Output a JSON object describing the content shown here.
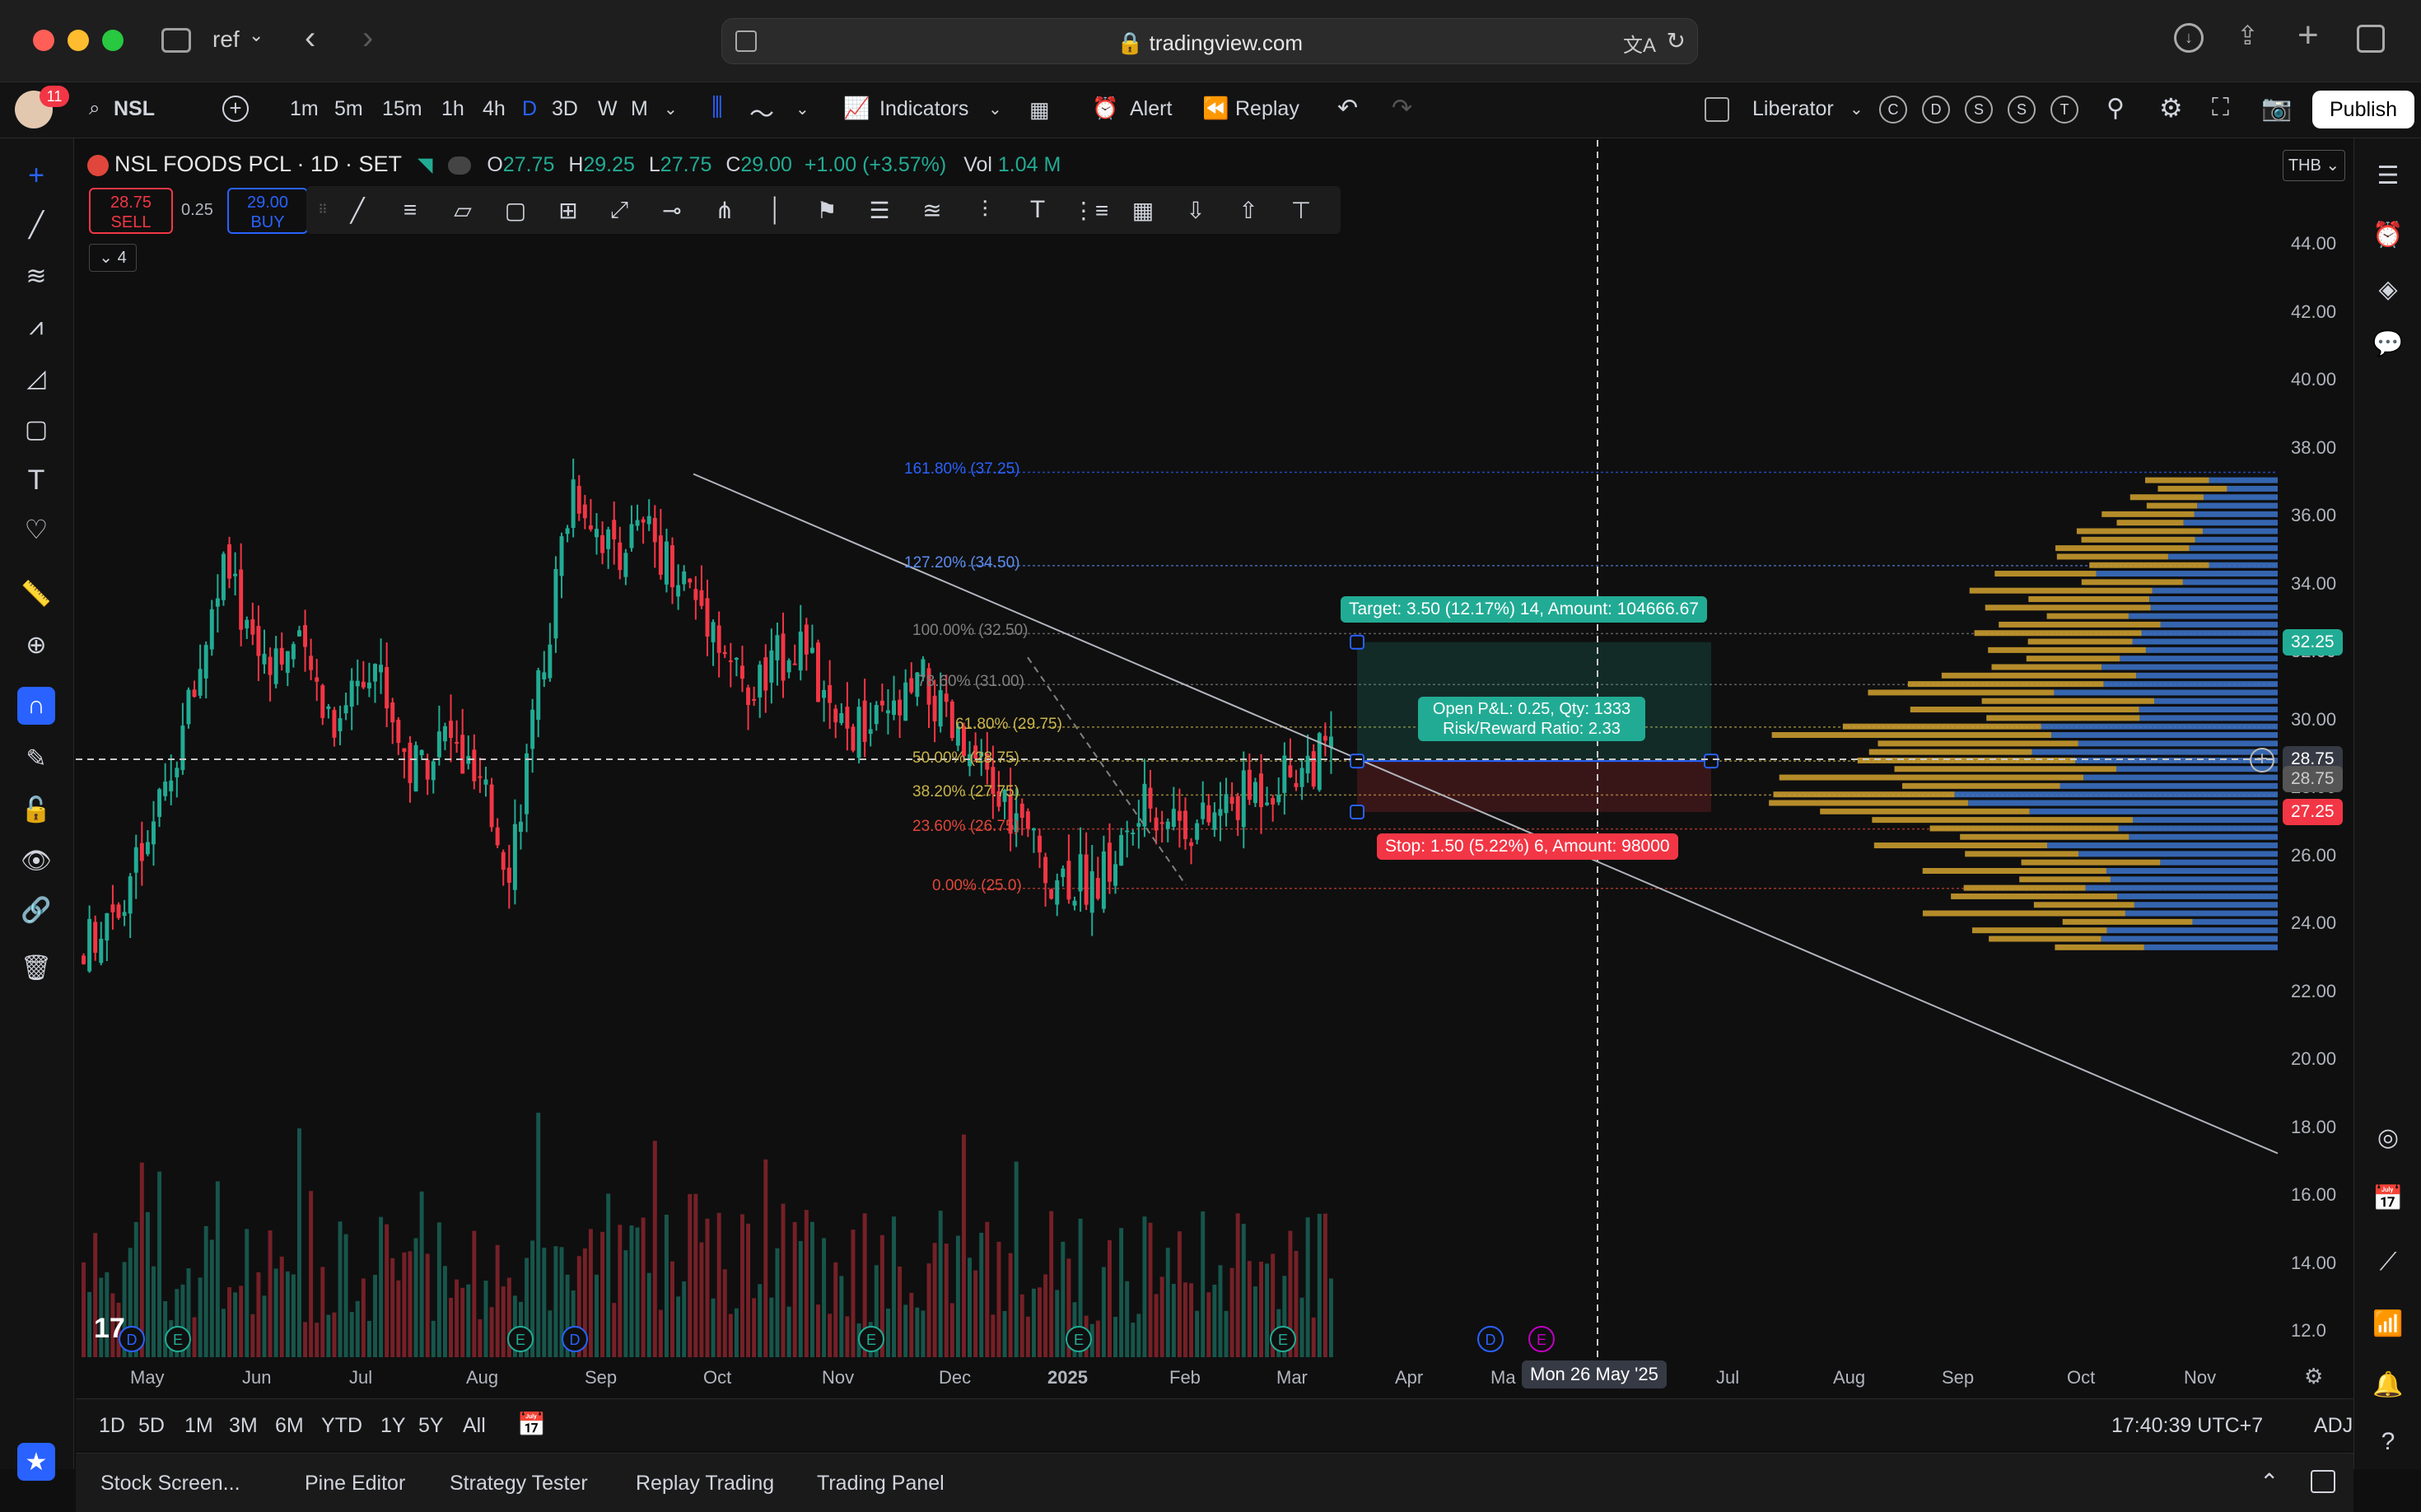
{
  "browser": {
    "url": "tradingview.com",
    "tab_group": "ref"
  },
  "toolbar": {
    "symbol": "NSL",
    "intervals": [
      "1m",
      "5m",
      "15m",
      "1h",
      "4h",
      "D",
      "3D",
      "W",
      "M"
    ],
    "indicators_label": "Indicators",
    "alert_label": "Alert",
    "replay_label": "Replay",
    "layout_name": "Liberator",
    "badges": [
      "C",
      "D",
      "S",
      "S",
      "T"
    ],
    "publish_label": "Publish",
    "notif_count": "11"
  },
  "legend": {
    "title": "NSL FOODS PCL · 1D · SET",
    "o_label": "O",
    "o": "27.75",
    "h_label": "H",
    "h": "29.25",
    "l_label": "L",
    "l": "27.75",
    "c_label": "C",
    "c": "29.00",
    "change": "+1.00 (+3.57%)",
    "vol_label": "Vol",
    "vol": "1.04 M",
    "sell_price": "28.75",
    "sell_label": "SELL",
    "spread": "0.25",
    "buy_price": "29.00",
    "buy_label": "BUY",
    "indicator_count": "4",
    "currency": "THB"
  },
  "price_axis": [
    "44.00",
    "42.00",
    "40.00",
    "38.00",
    "36.00",
    "34.00",
    "32.00",
    "30.00",
    "28.00",
    "26.00",
    "24.00",
    "22.00",
    "20.00",
    "18.00",
    "16.00",
    "14.00",
    "12.0"
  ],
  "price_tags": {
    "target": "32.25",
    "current": "28.75",
    "below": "28.75",
    "stop": "27.25"
  },
  "fib_levels": [
    {
      "label": "161.80% (37.25)",
      "price": 37.25,
      "color": "#2962ff"
    },
    {
      "label": "127.20% (34.50)",
      "price": 34.5,
      "color": "#5b8def"
    },
    {
      "label": "100.00% (32.50)",
      "price": 32.5,
      "color": "#808080"
    },
    {
      "label": "78.60% (31.00)",
      "price": 31.0,
      "color": "#808080"
    },
    {
      "label": "61.80% (29.75)",
      "price": 29.75,
      "color": "#c9b44a"
    },
    {
      "label": "50.00% (28.75)",
      "price": 28.75,
      "color": "#c9b44a"
    },
    {
      "label": "38.20% (27.75)",
      "price": 27.75,
      "color": "#c9b44a"
    },
    {
      "label": "23.60% (26.75)",
      "price": 26.75,
      "color": "#e0463b"
    },
    {
      "label": "0.00% (25.0)",
      "price": 25.0,
      "color": "#e0463b"
    }
  ],
  "position": {
    "target_label": "Target: 3.50 (12.17%) 14, Amount: 104666.67",
    "pnl_label": "Open P&L: 0.25, Qty: 1333",
    "rr_label": "Risk/Reward Ratio: 2.33",
    "stop_label": "Stop: 1.50 (5.22%) 6, Amount: 98000"
  },
  "time_axis": [
    "May",
    "Jun",
    "Jul",
    "Aug",
    "Sep",
    "Oct",
    "Nov",
    "Dec",
    "2025",
    "Feb",
    "Mar",
    "Apr",
    "Ma",
    "Jul",
    "Aug",
    "Sep",
    "Oct",
    "Nov"
  ],
  "crosshair_time": "Mon 26 May '25",
  "ranges": [
    "1D",
    "5D",
    "1M",
    "3M",
    "6M",
    "YTD",
    "1Y",
    "5Y",
    "All"
  ],
  "clock": "17:40:39 UTC+7",
  "adj_label": "ADJ",
  "bottom_tabs": [
    "Stock Screen...",
    "Pine Editor",
    "Strategy Tester",
    "Replay Trading",
    "Trading Panel"
  ],
  "event_markers": {
    "dividend": "D",
    "earnings": "E"
  },
  "colors": {
    "up": "#22ab94",
    "down": "#f23645",
    "accent": "#2962ff",
    "volume_profile_up": "#3a6fc1",
    "volume_profile_down": "#c89a2e"
  }
}
